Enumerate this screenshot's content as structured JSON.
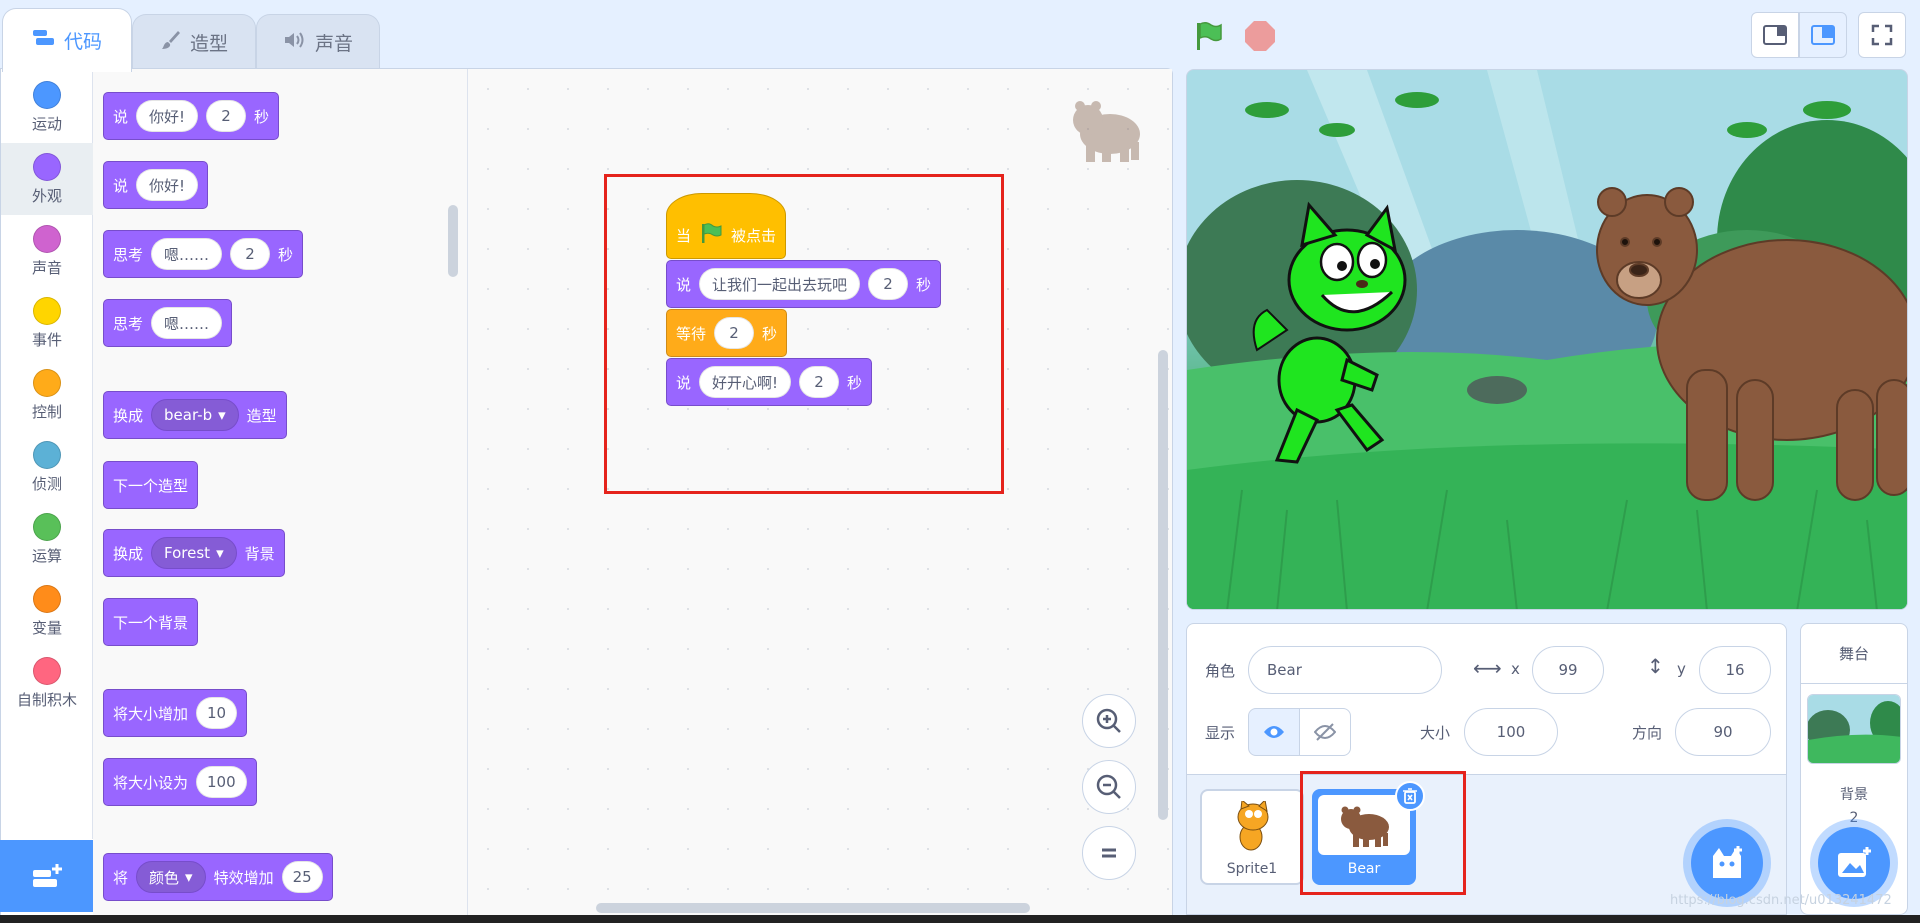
{
  "tabs": {
    "code": "代码",
    "costumes": "造型",
    "sounds": "声音"
  },
  "categories": [
    {
      "label": "运动",
      "color": "#4c97ff"
    },
    {
      "label": "外观",
      "color": "#9966ff"
    },
    {
      "label": "声音",
      "color": "#cf63cf"
    },
    {
      "label": "事件",
      "color": "#ffd500"
    },
    {
      "label": "控制",
      "color": "#ffab19"
    },
    {
      "label": "侦测",
      "color": "#5cb1d6"
    },
    {
      "label": "运算",
      "color": "#59c059"
    },
    {
      "label": "变量",
      "color": "#ff8c1a"
    },
    {
      "label": "自制积木",
      "color": "#ff6680"
    }
  ],
  "palette": {
    "say": "说",
    "think": "思考",
    "seconds": "秒",
    "hello": "你好!",
    "hmm": "嗯……",
    "two": "2",
    "switch": "换成",
    "costume_val": "bear-b",
    "costume_suffix": "造型",
    "next_costume": "下一个造型",
    "backdrop_val": "Forest",
    "backdrop_suffix": "背景",
    "next_backdrop": "下一个背景",
    "change_size": "将大小增加",
    "change_size_val": "10",
    "set_size": "将大小设为",
    "set_size_val": "100",
    "effect_prefix": "将",
    "effect_val": "颜色",
    "effect_suffix": "特效增加",
    "effect_amount": "25"
  },
  "script": {
    "hat_when": "当",
    "hat_clicked": "被点击",
    "say1": "说",
    "say1_text": "让我们一起出去玩吧",
    "say1_secs": "2",
    "secs": "秒",
    "wait": "等待",
    "wait_secs": "2",
    "say2": "说",
    "say2_text": "好开心啊!",
    "say2_secs": "2"
  },
  "sprite_info": {
    "sprite_label": "角色",
    "sprite_name": "Bear",
    "x_label": "x",
    "x": "99",
    "y_label": "y",
    "y": "16",
    "show_label": "显示",
    "size_label": "大小",
    "size": "100",
    "direction_label": "方向",
    "direction": "90"
  },
  "sprites": [
    {
      "name": "Sprite1"
    },
    {
      "name": "Bear"
    }
  ],
  "stage_pane": {
    "title": "舞台",
    "backdrops_label": "背景",
    "backdrops_count": "2"
  },
  "watermark": "https://blog.csdn.net/u013241472"
}
